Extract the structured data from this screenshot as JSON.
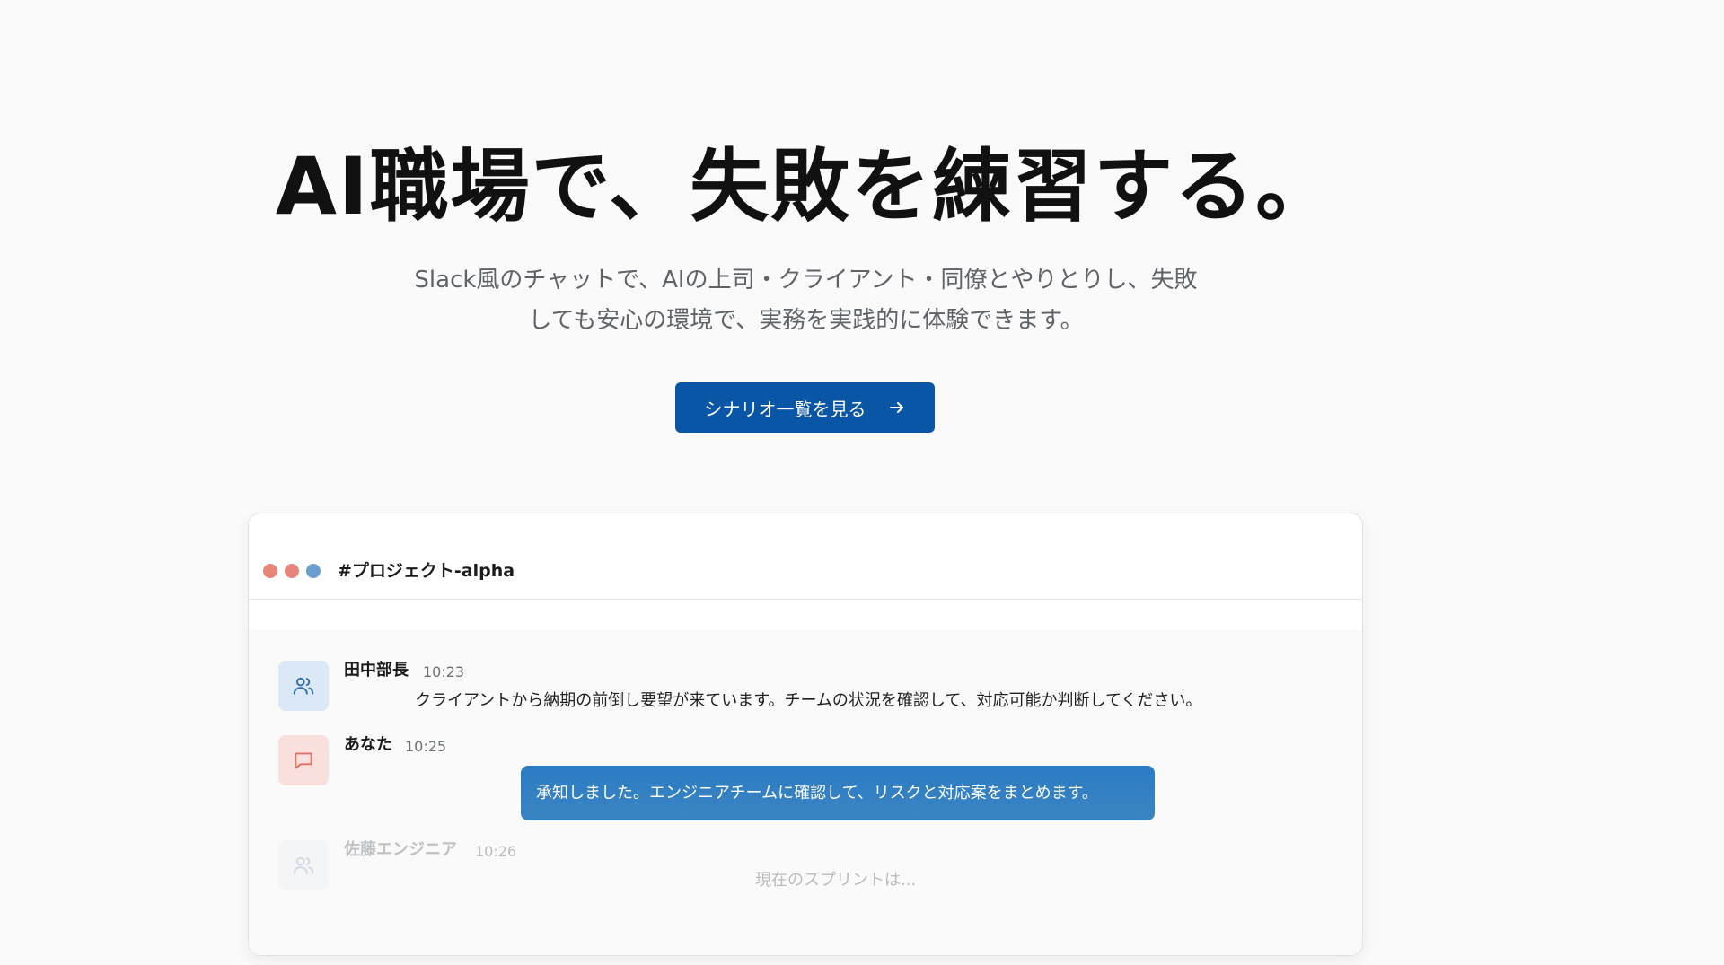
{
  "hero": {
    "title": "AI職場で、失敗を練習する。",
    "subtitle_line1": "Slack風のチャットで、AIの上司・クライアント・同僚とやりとりし、失敗",
    "subtitle_line2": "しても安心の環境で、実務を実践的に体験できます。",
    "cta_label": "シナリオ一覧を見る"
  },
  "chat": {
    "channel": "#プロジェクト-alpha",
    "window_dot_colors": [
      "#e8847a",
      "#e8847a",
      "#6a9ed1"
    ],
    "messages": [
      {
        "author": "田中部長",
        "time": "10:23",
        "text": "クライアントから納期の前倒し要望が来ています。チームの状況を確認して、対応可能か判断してください。",
        "avatar_icon": "users-icon",
        "avatar_bg": "#dbe8f5",
        "avatar_color": "#2f6fb0"
      },
      {
        "author": "あなた",
        "time": "10:25",
        "text": "承知しました。エンジニアチームに確認して、リスクと対応案をまとめます。",
        "avatar_icon": "message-square-icon",
        "avatar_bg": "#f9e0dd",
        "avatar_color": "#e07167"
      },
      {
        "author": "佐藤エンジニア",
        "time": "10:26",
        "text": "現在のスプリントは...",
        "avatar_icon": "users-icon",
        "avatar_bg": "#eef1f4",
        "avatar_color": "#9fb3c8"
      }
    ]
  },
  "colors": {
    "accent": "#0a56a6",
    "page_bg": "#fafafa"
  }
}
